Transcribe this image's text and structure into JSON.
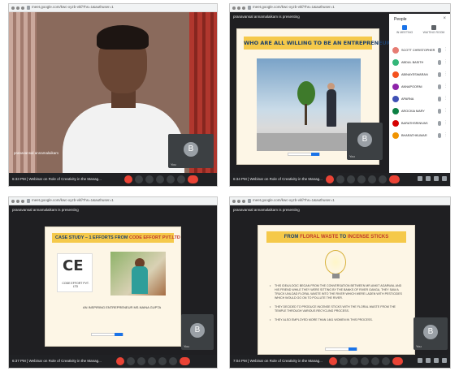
{
  "panels": {
    "p1": {
      "url": "meet.google.com/kwc-xyzb-vkf/?hs=1&authuser=1",
      "time": "6:33 PM",
      "meeting_title": "Webinar on Role of Creativity in the Manag...",
      "participant_name": "pranavansal annamalaikam",
      "you_avatar": "B",
      "you_label": "You"
    },
    "p2": {
      "url": "meet.google.com/kwc-xyzb-vkf/?hs=1&authuser=1",
      "presenter": "pranavansal annamalaikam is presenting",
      "slide_title": "WHO ARE ALL WILLING TO BE AN ENTREPRENEUR ??",
      "time": "6:34 PM",
      "meeting_title": "Webinar on Role of Creativity in the Manag...",
      "you_avatar": "B",
      "you_label": "You",
      "people_panel": {
        "title": "People",
        "close": "×",
        "tab1": "IN MEETING",
        "tab2": "WAITING ROOM",
        "participants": [
          {
            "name": "SCOTT CHRISTOPHER",
            "color": "#e67c73"
          },
          {
            "name": "ABDUL BASITH",
            "color": "#33b679"
          },
          {
            "name": "ABINAYESWARAN",
            "color": "#f4511e"
          },
          {
            "name": "ANNAPOORNI",
            "color": "#8e24aa"
          },
          {
            "name": "APARNA",
            "color": "#3f51b5"
          },
          {
            "name": "AROCKIA MARY",
            "color": "#0b8043"
          },
          {
            "name": "BARATHSRINIVAS",
            "color": "#d50000"
          },
          {
            "name": "BHARATHKUMAR",
            "color": "#f09300"
          }
        ],
        "more_glyph": "⋮"
      }
    },
    "p3": {
      "url": "meet.google.com/kwc-xyzb-vkf/?hs=1&authuser=1",
      "presenter": "pranavansal annamalaikam is presenting",
      "slide_title_prefix": "CASE STUDY – 1  EFFORTS FROM ",
      "slide_title_highlight": "CODE EFFORT PVT.LTD",
      "logo_text": "CE",
      "logo_caption": "CODE EFFORT PVT. LTD",
      "caption": "AN INSPIRING ENTREPRENEUR MS.NAINA GUPTA",
      "time": "6:37 PM",
      "meeting_title": "Webinar on Role of Creativity in the Manag...",
      "you_avatar": "B",
      "you_label": "You"
    },
    "p4": {
      "url": "meet.google.com/kwc-xyzb-vkf/?hs=1&authuser=1",
      "presenter": "pranavansal annamalaikam is presenting",
      "slide_title_1": "FROM ",
      "slide_title_2": "FLORAL WASTE",
      "slide_title_3": " TO ",
      "slide_title_4": "INCENSE STICKS",
      "bullets": [
        "THIS IDEA/LOGIC BEGAN FROM THE CONVERSATION BETWEEN MR.ANKIT AGARWAL AND HIS FRIEND WHILE THEY WERE SITTING BY THE BANKS OF RIVER GANGA, THEY SAW A TRUCK UNLOAD FLORAL WASTE INTO THE RIVER WHICH WERE LADEN WITH PESTICIDES WHICH WOULD GO ON TO POLLUTE THE RIVER.",
        "THEY DECIDED TO PRODUCE INCENSE STICKS WITH THE FLORAL WASTE FROM THE TEMPLE THROUGH VARIOUS RECYCLING PROCESS.",
        "THEY ALSO EMPLOYED MORE THAN 1461 WOMEN IN THIS PROCESS."
      ],
      "time": "7:04 PM",
      "meeting_title": "Webinar on Role of Creativity in the Manag...",
      "you_avatar": "B",
      "you_label": "You"
    }
  }
}
